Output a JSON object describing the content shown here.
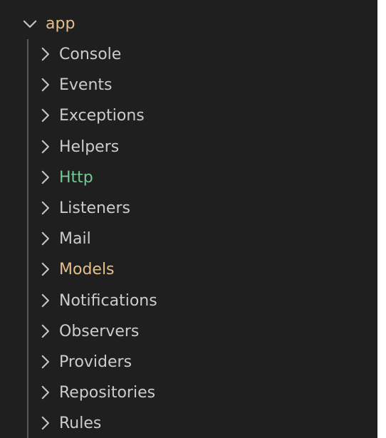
{
  "explorer": {
    "root": {
      "label": "app",
      "icon": "chevron-down-icon",
      "color": "#e2c08d",
      "expanded": true
    },
    "items": [
      {
        "label": "Console",
        "icon": "chevron-right-icon",
        "color": "#cccccc",
        "expanded": false
      },
      {
        "label": "Events",
        "icon": "chevron-right-icon",
        "color": "#cccccc",
        "expanded": false
      },
      {
        "label": "Exceptions",
        "icon": "chevron-right-icon",
        "color": "#cccccc",
        "expanded": false
      },
      {
        "label": "Helpers",
        "icon": "chevron-right-icon",
        "color": "#cccccc",
        "expanded": false
      },
      {
        "label": "Http",
        "icon": "chevron-right-icon",
        "color": "#73c991",
        "expanded": false
      },
      {
        "label": "Listeners",
        "icon": "chevron-right-icon",
        "color": "#cccccc",
        "expanded": false
      },
      {
        "label": "Mail",
        "icon": "chevron-right-icon",
        "color": "#cccccc",
        "expanded": false
      },
      {
        "label": "Models",
        "icon": "chevron-right-icon",
        "color": "#e2c08d",
        "expanded": false
      },
      {
        "label": "Notifications",
        "icon": "chevron-right-icon",
        "color": "#cccccc",
        "expanded": false
      },
      {
        "label": "Observers",
        "icon": "chevron-right-icon",
        "color": "#cccccc",
        "expanded": false
      },
      {
        "label": "Providers",
        "icon": "chevron-right-icon",
        "color": "#cccccc",
        "expanded": false
      },
      {
        "label": "Repositories",
        "icon": "chevron-right-icon",
        "color": "#cccccc",
        "expanded": false
      },
      {
        "label": "Rules",
        "icon": "chevron-right-icon",
        "color": "#cccccc",
        "expanded": false
      }
    ]
  }
}
